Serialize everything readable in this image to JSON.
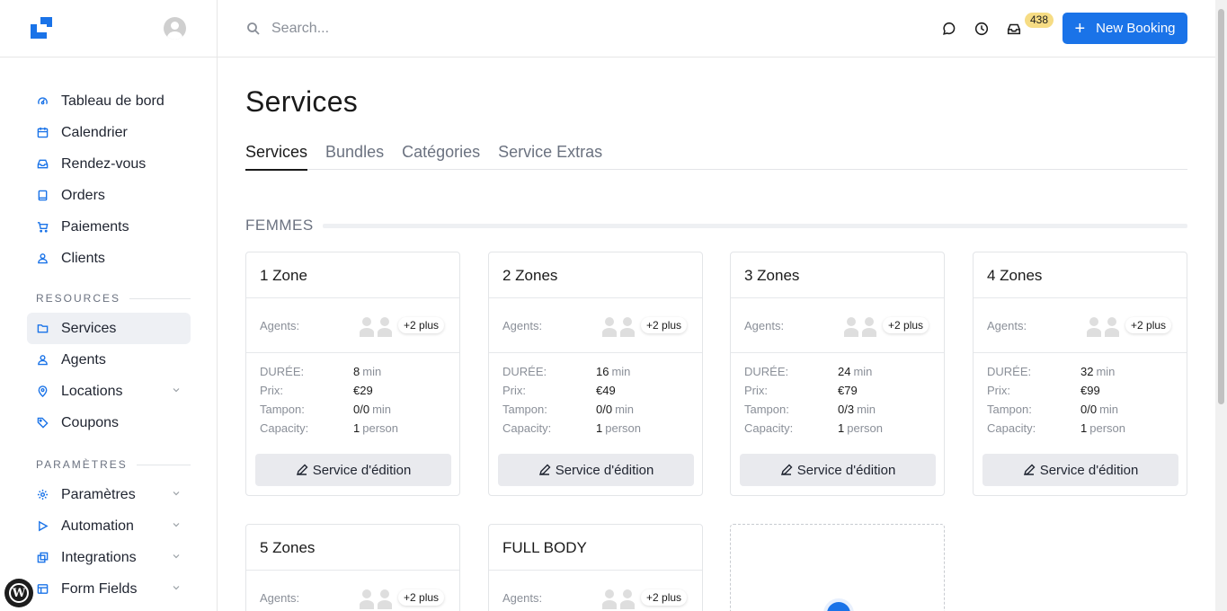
{
  "user": {
    "avatar": "user-avatar-icon"
  },
  "sidebar": {
    "main_items": [
      {
        "label": "Tableau de bord",
        "icon": "dashboard-icon"
      },
      {
        "label": "Calendrier",
        "icon": "calendar-icon"
      },
      {
        "label": "Rendez-vous",
        "icon": "inbox-icon"
      },
      {
        "label": "Orders",
        "icon": "book-icon"
      },
      {
        "label": "Paiements",
        "icon": "cart-icon"
      },
      {
        "label": "Clients",
        "icon": "user-icon"
      }
    ],
    "resources_title": "RESOURCES",
    "resources_items": [
      {
        "label": "Services",
        "icon": "folder-icon",
        "active": true
      },
      {
        "label": "Agents",
        "icon": "user-icon"
      },
      {
        "label": "Locations",
        "icon": "map-pin-icon",
        "expandable": true
      },
      {
        "label": "Coupons",
        "icon": "tag-icon"
      }
    ],
    "settings_title": "PARAMÈTRES",
    "settings_items": [
      {
        "label": "Paramètres",
        "icon": "gear-icon",
        "expandable": true
      },
      {
        "label": "Automation",
        "icon": "play-icon",
        "expandable": true
      },
      {
        "label": "Integrations",
        "icon": "integrations-icon",
        "expandable": true
      },
      {
        "label": "Form Fields",
        "icon": "form-icon",
        "expandable": true
      }
    ]
  },
  "topbar": {
    "search_placeholder": "Search...",
    "notifications_count": "438",
    "new_booking_label": "New Booking"
  },
  "page": {
    "title": "Services",
    "tabs": [
      "Services",
      "Bundles",
      "Catégories",
      "Service Extras"
    ],
    "active_tab": 0
  },
  "group": {
    "title": "FEMMES",
    "labels": {
      "agents": "Agents:",
      "duration": "DURÉE:",
      "price": "Prix:",
      "buffer": "Tampon:",
      "capacity": "Capacity:",
      "edit": "Service d'édition",
      "more_agents": "+2 plus",
      "min": "min",
      "person": "person"
    },
    "services": [
      {
        "name": "1 Zone",
        "duration": "8",
        "price": "€29",
        "buffer": "0/0",
        "capacity": "1"
      },
      {
        "name": "2 Zones",
        "duration": "16",
        "price": "€49",
        "buffer": "0/0",
        "capacity": "1"
      },
      {
        "name": "3 Zones",
        "duration": "24",
        "price": "€79",
        "buffer": "0/3",
        "capacity": "1"
      },
      {
        "name": "4 Zones",
        "duration": "32",
        "price": "€99",
        "buffer": "0/0",
        "capacity": "1"
      },
      {
        "name": "5 Zones"
      },
      {
        "name": "FULL BODY"
      }
    ]
  },
  "colors": {
    "accent": "#1a73e8",
    "badge": "#f6dc84"
  }
}
